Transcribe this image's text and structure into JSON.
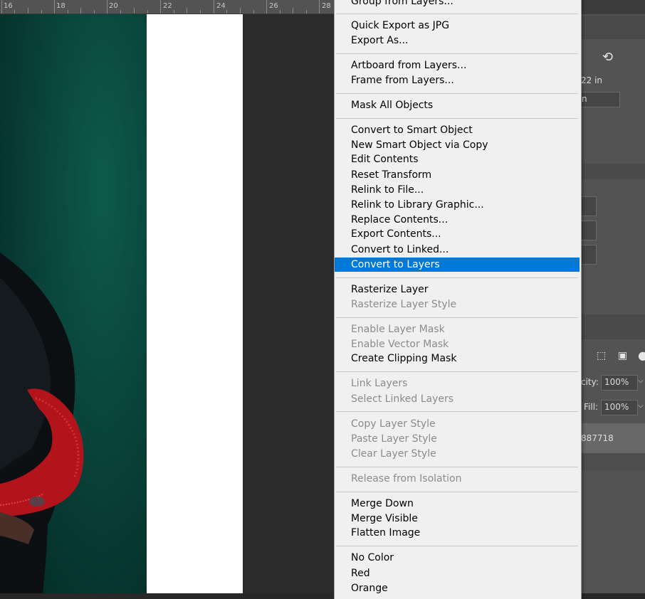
{
  "ruler": {
    "labels": [
      "16",
      "18",
      "20",
      "22",
      "24",
      "26",
      "28"
    ]
  },
  "panels": {
    "dimension_partial": "22 in",
    "field_partial": "n",
    "opacity_label": "city:",
    "opacity_value": "100%",
    "fill_label": "Fill:",
    "fill_value": "100%",
    "layer_name_partial": "887718"
  },
  "menu": {
    "items": [
      {
        "label": "Group from Layers...",
        "disabled": false
      },
      {
        "label": "Quick Export as JPG",
        "disabled": false
      },
      {
        "label": "Export As...",
        "disabled": false
      },
      {
        "label": "Artboard from Layers...",
        "disabled": false
      },
      {
        "label": "Frame from Layers...",
        "disabled": false
      },
      {
        "label": "Mask All Objects",
        "disabled": false
      },
      {
        "label": "Convert to Smart Object",
        "disabled": false
      },
      {
        "label": "New Smart Object via Copy",
        "disabled": false
      },
      {
        "label": "Edit Contents",
        "disabled": false
      },
      {
        "label": "Reset Transform",
        "disabled": false
      },
      {
        "label": "Relink to File...",
        "disabled": false
      },
      {
        "label": "Relink to Library Graphic...",
        "disabled": false
      },
      {
        "label": "Replace Contents...",
        "disabled": false
      },
      {
        "label": "Export Contents...",
        "disabled": false
      },
      {
        "label": "Convert to Linked...",
        "disabled": false
      },
      {
        "label": "Convert to Layers",
        "disabled": false,
        "highlighted": true
      },
      {
        "label": "Rasterize Layer",
        "disabled": false
      },
      {
        "label": "Rasterize Layer Style",
        "disabled": true
      },
      {
        "label": "Enable Layer Mask",
        "disabled": true
      },
      {
        "label": "Enable Vector Mask",
        "disabled": true
      },
      {
        "label": "Create Clipping Mask",
        "disabled": false
      },
      {
        "label": "Link Layers",
        "disabled": true
      },
      {
        "label": "Select Linked Layers",
        "disabled": true
      },
      {
        "label": "Copy Layer Style",
        "disabled": true
      },
      {
        "label": "Paste Layer Style",
        "disabled": true
      },
      {
        "label": "Clear Layer Style",
        "disabled": true
      },
      {
        "label": "Release from Isolation",
        "disabled": true
      },
      {
        "label": "Merge Down",
        "disabled": false
      },
      {
        "label": "Merge Visible",
        "disabled": false
      },
      {
        "label": "Flatten Image",
        "disabled": false
      },
      {
        "label": "No Color",
        "disabled": false
      },
      {
        "label": "Red",
        "disabled": false
      },
      {
        "label": "Orange",
        "disabled": false
      }
    ]
  },
  "colors": {
    "highlight": "#0078d7",
    "menu_bg": "#f0f0f0",
    "disabled_text": "#8b8b8b",
    "canvas_teal": "#08423a"
  }
}
